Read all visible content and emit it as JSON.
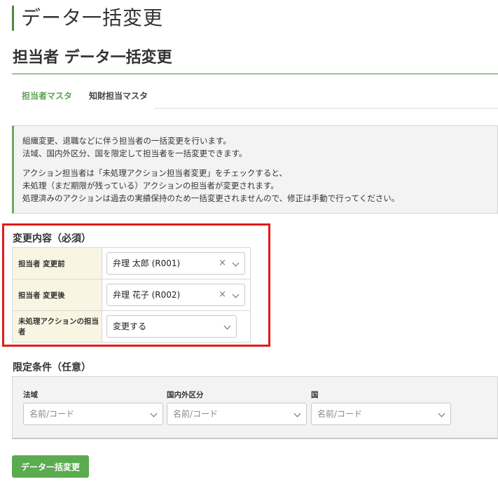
{
  "page": {
    "title": "データ一括変更"
  },
  "section": {
    "title": "担当者 データ一括変更"
  },
  "tabs": [
    {
      "label": "担当者マスタ",
      "active": true
    },
    {
      "label": "知財担当マスタ",
      "active": false
    }
  ],
  "info": {
    "line1": "組織変更、退職などに伴う担当者の一括変更を行います。",
    "line2": "法域、国内外区分、国を限定して担当者を一括変更できます。",
    "line3": "アクション担当者は「未処理アクション担当者変更」をチェックすると、",
    "line4": "未処理（まだ期限が残っている）アクションの担当者が変更されます。",
    "line5": "処理済みのアクションは過去の実績保持のため一括変更されませんので、修正は手動で行ってください。"
  },
  "required": {
    "heading": "変更内容（必須）",
    "rows": [
      {
        "label": "担当者 変更前",
        "value": "弁理 太郎 (R001)",
        "clear": "×"
      },
      {
        "label": "担当者 変更後",
        "value": "弁理 花子 (R002)",
        "clear": "×"
      },
      {
        "label": "未処理アクションの担当者",
        "value": "変更する"
      }
    ]
  },
  "optional": {
    "heading": "限定条件（任意）",
    "fields": [
      {
        "label": "法域",
        "placeholder": "名前/コード"
      },
      {
        "label": "国内外区分",
        "placeholder": "名前/コード"
      },
      {
        "label": "国",
        "placeholder": "名前/コード"
      }
    ]
  },
  "submit": {
    "label": "データ一括変更",
    "color": "#5aac4f"
  },
  "colors": {
    "accent": "#4a8c3f",
    "highlight_border": "#e21a1a",
    "table_header_bg": "#f8f6e2"
  }
}
